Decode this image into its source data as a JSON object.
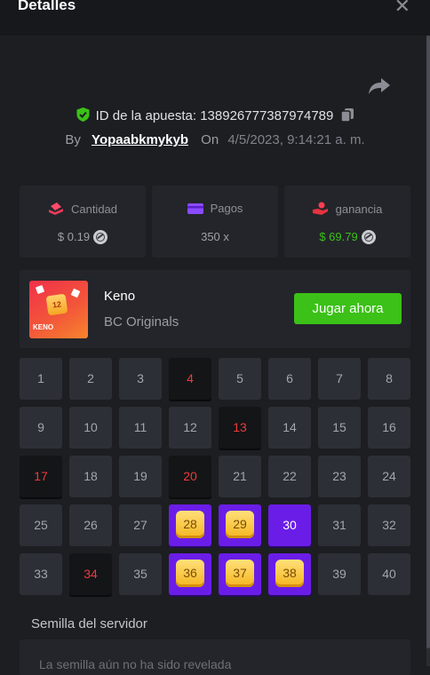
{
  "header": {
    "title": "Detalles"
  },
  "bet": {
    "id_label": "ID de la apuesta:",
    "id_value": "138926777387974789",
    "by_label": "By",
    "username": "Yopaabkmykyb",
    "on_label": "On",
    "date": "4/5/2023, 9:14:21 a. m."
  },
  "stats": {
    "amount": {
      "label": "Cantidad",
      "value": "$ 0.19"
    },
    "payout": {
      "label": "Pagos",
      "value": "350 x"
    },
    "profit": {
      "label": "ganancia",
      "value": "$ 69.79"
    }
  },
  "game": {
    "name": "Keno",
    "provider": "BC Originals",
    "play_label": "Jugar ahora",
    "thumb_number": "12",
    "thumb_logo": "KENO"
  },
  "grid": {
    "numbers": [
      "1",
      "2",
      "3",
      "4",
      "5",
      "6",
      "7",
      "8",
      "9",
      "10",
      "11",
      "12",
      "13",
      "14",
      "15",
      "16",
      "17",
      "18",
      "19",
      "20",
      "21",
      "22",
      "23",
      "24",
      "25",
      "26",
      "27",
      "28",
      "29",
      "30",
      "31",
      "32",
      "33",
      "34",
      "35",
      "36",
      "37",
      "38",
      "39",
      "40"
    ],
    "states": [
      "n",
      "n",
      "n",
      "miss",
      "n",
      "n",
      "n",
      "n",
      "n",
      "n",
      "n",
      "n",
      "miss",
      "n",
      "n",
      "n",
      "miss",
      "n",
      "n",
      "miss",
      "n",
      "n",
      "n",
      "n",
      "n",
      "n",
      "n",
      "selhit",
      "selhit",
      "hit",
      "n",
      "n",
      "n",
      "miss",
      "n",
      "selhit",
      "selhit",
      "selhit",
      "n",
      "n"
    ]
  },
  "seed": {
    "label": "Semilla del servidor",
    "text": "La semilla aún no ha sido revelada"
  },
  "colors": {
    "accent_green": "#3bc117",
    "hit_purple": "#6b1de8",
    "miss_red": "#ed3b3b",
    "gem_gold": "#f4b51f"
  }
}
